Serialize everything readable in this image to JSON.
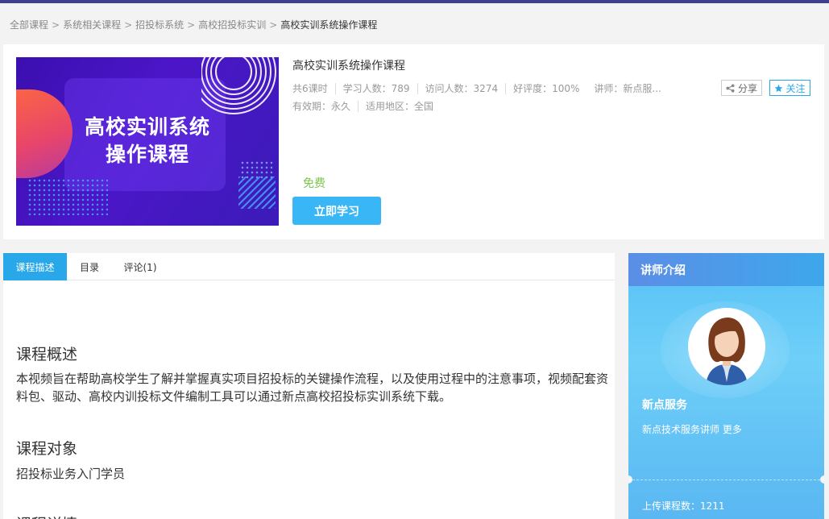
{
  "breadcrumb": {
    "items": [
      "全部课程",
      "系统相关课程",
      "招投标系统",
      "高校招投标实训",
      "高校实训系统操作课程"
    ],
    "separator": ">"
  },
  "course": {
    "cover_title_line1": "高校实训系统",
    "cover_title_line2": "操作课程",
    "name": "高校实训系统操作课程",
    "meta": {
      "lessons": "共6课时",
      "learners": "学习人数：789",
      "visits": "访问人数：3274",
      "rating": "好评度：100%",
      "teacher": "讲师：新点服..."
    },
    "validity": "有效期：永久",
    "region": "适用地区：全国",
    "price": "免费",
    "study_label": "立即学习",
    "share_label": "分享",
    "follow_label": "关注"
  },
  "tabs": [
    "课程描述",
    "目录",
    "评论(1)"
  ],
  "content": {
    "overview_title": "课程概述",
    "overview_text": "本视频旨在帮助高校学生了解并掌握真实项目招投标的关键操作流程，以及使用过程中的注意事项，视频配套资料包、驱动、高校内训投标文件编制工具可以通过新点高校招投标实训系统下载。",
    "audience_title": "课程对象",
    "audience_text": "招投标业务入门学员",
    "details_title": "课程详情"
  },
  "teacher": {
    "header": "讲师介绍",
    "name": "新点服务",
    "desc": "新点技术服务讲师",
    "more": "更多",
    "uploads": "上传课程数：1211"
  },
  "colors": {
    "accent": "#29a8e9",
    "button": "#38b6f5",
    "price": "#7cc44f"
  }
}
